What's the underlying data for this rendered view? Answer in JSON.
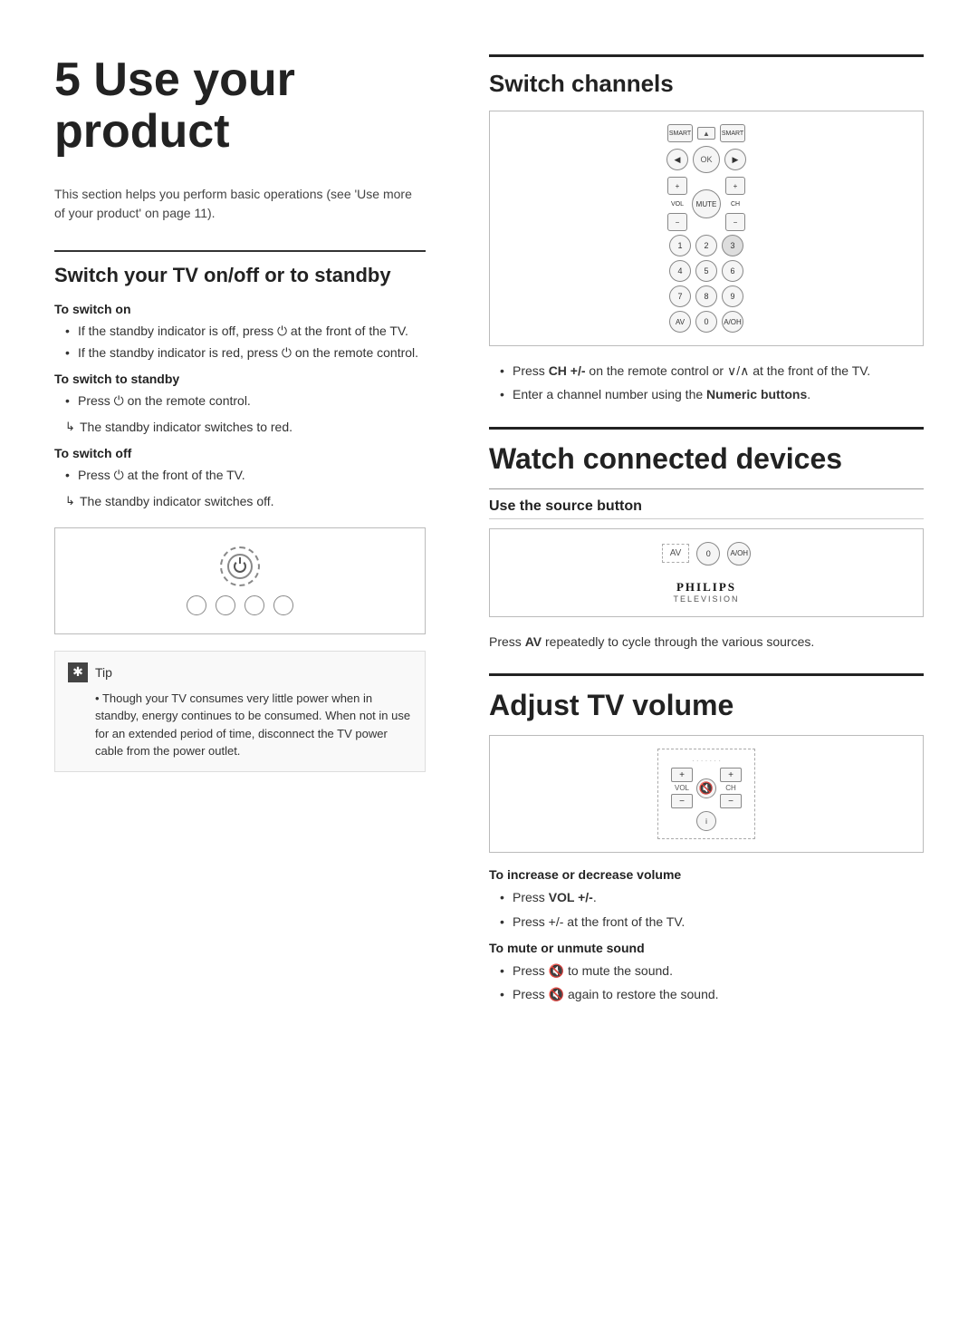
{
  "page": {
    "chapter_number": "5",
    "chapter_title": "Use your\nproduct",
    "intro": "This section helps you perform basic operations (see 'Use more of your product' on page 11).",
    "left": {
      "section1": {
        "title": "Switch your TV on/off or to standby",
        "sub1": {
          "heading": "To switch on",
          "bullets": [
            "If the standby indicator is off, press Ⓟ at the front of the TV.",
            "If the standby indicator is red, press Ⓟ on the remote control."
          ]
        },
        "sub2": {
          "heading": "To switch to standby",
          "bullets": [
            "Press Ⓟ on the remote control."
          ],
          "arrow": "The standby indicator switches to red."
        },
        "sub3": {
          "heading": "To switch off",
          "bullets": [
            "Press Ⓟ at the front of the TV."
          ],
          "arrow": "The standby indicator switches off."
        }
      },
      "tip": {
        "label": "Tip",
        "text": "Though your TV consumes very little power when in standby, energy continues to be consumed. When not in use for an extended period of time, disconnect the TV power cable from the power outlet."
      }
    },
    "right": {
      "section1": {
        "title": "Switch channels",
        "bullets": [
          "Press CH +/- on the remote control or ∨/∧ at the front of the TV.",
          "Enter a channel number using the Numeric buttons."
        ],
        "bold_parts": [
          "CH +/-",
          "Numeric buttons"
        ]
      },
      "section2": {
        "title": "Watch connected devices",
        "sub_title": "Use the source button",
        "body": "Press AV repeatedly to cycle through the various sources.",
        "bold_in_body": [
          "AV"
        ]
      },
      "section3": {
        "title": "Adjust TV volume",
        "sub1": {
          "heading": "To increase or decrease volume",
          "bullets": [
            "Press VOL +/-.",
            "Press +/- at the front of the TV."
          ],
          "bold_parts": [
            "VOL +/-"
          ]
        },
        "sub2": {
          "heading": "To mute or unmute sound",
          "bullets": [
            "Press 🔇 to mute the sound.",
            "Press 🔇 again to restore the sound."
          ]
        }
      }
    }
  }
}
